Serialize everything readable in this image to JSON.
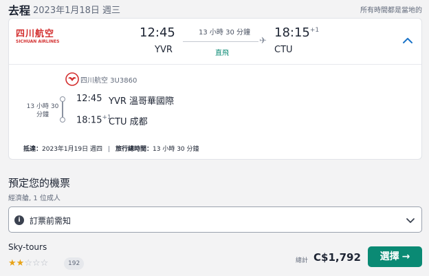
{
  "header": {
    "title": "去程",
    "date": "2023年1月18日 週三",
    "timezone_note": "所有時間都是當地的"
  },
  "flight": {
    "airline_logo_cn": "四川航空",
    "airline_logo_en": "SICHUAN AIRLINES",
    "departure_time": "12:45",
    "departure_code": "YVR",
    "duration": "13 小時 30 分鐘",
    "stops": "直飛",
    "arrival_time": "18:15",
    "arrival_day_offset": "+1",
    "arrival_code": "CTU",
    "collapse_icon": "chevron-up-icon",
    "plane_icon": "plane-icon"
  },
  "segment": {
    "airline": "四川航空 3U3860",
    "duration": "13 小時 30 分鐘",
    "departure_time": "12:45",
    "departure_airport": "YVR 溫哥華國際",
    "arrival_time": "18:15",
    "arrival_day_offset": "+1",
    "arrival_airport": "CTU 成都"
  },
  "summary": {
    "arrival_label": "抵達：",
    "arrival_value": "2023年1月19日 週四",
    "separator": "|",
    "total_label": "旅行總時間：",
    "total_value": "13 小時 30 分鐘"
  },
  "booking": {
    "title": "預定您的機票",
    "subtitle": "經濟艙, 1 位成人",
    "notice_label": "訂票前需知",
    "notice_icon": "info-icon",
    "notice_chevron": "chevron-down-icon"
  },
  "agent": {
    "name": "Sky-tours",
    "rating": 2,
    "rating_max": 5,
    "review_count": "192",
    "total_prefix": "總計",
    "price": "C$1,792",
    "select_label": "選擇",
    "select_arrow": "→"
  },
  "colors": {
    "accent": "#0a8a74",
    "star": "#e8a317",
    "brand_red": "#d32f2f",
    "link_blue": "#1a73c8"
  }
}
